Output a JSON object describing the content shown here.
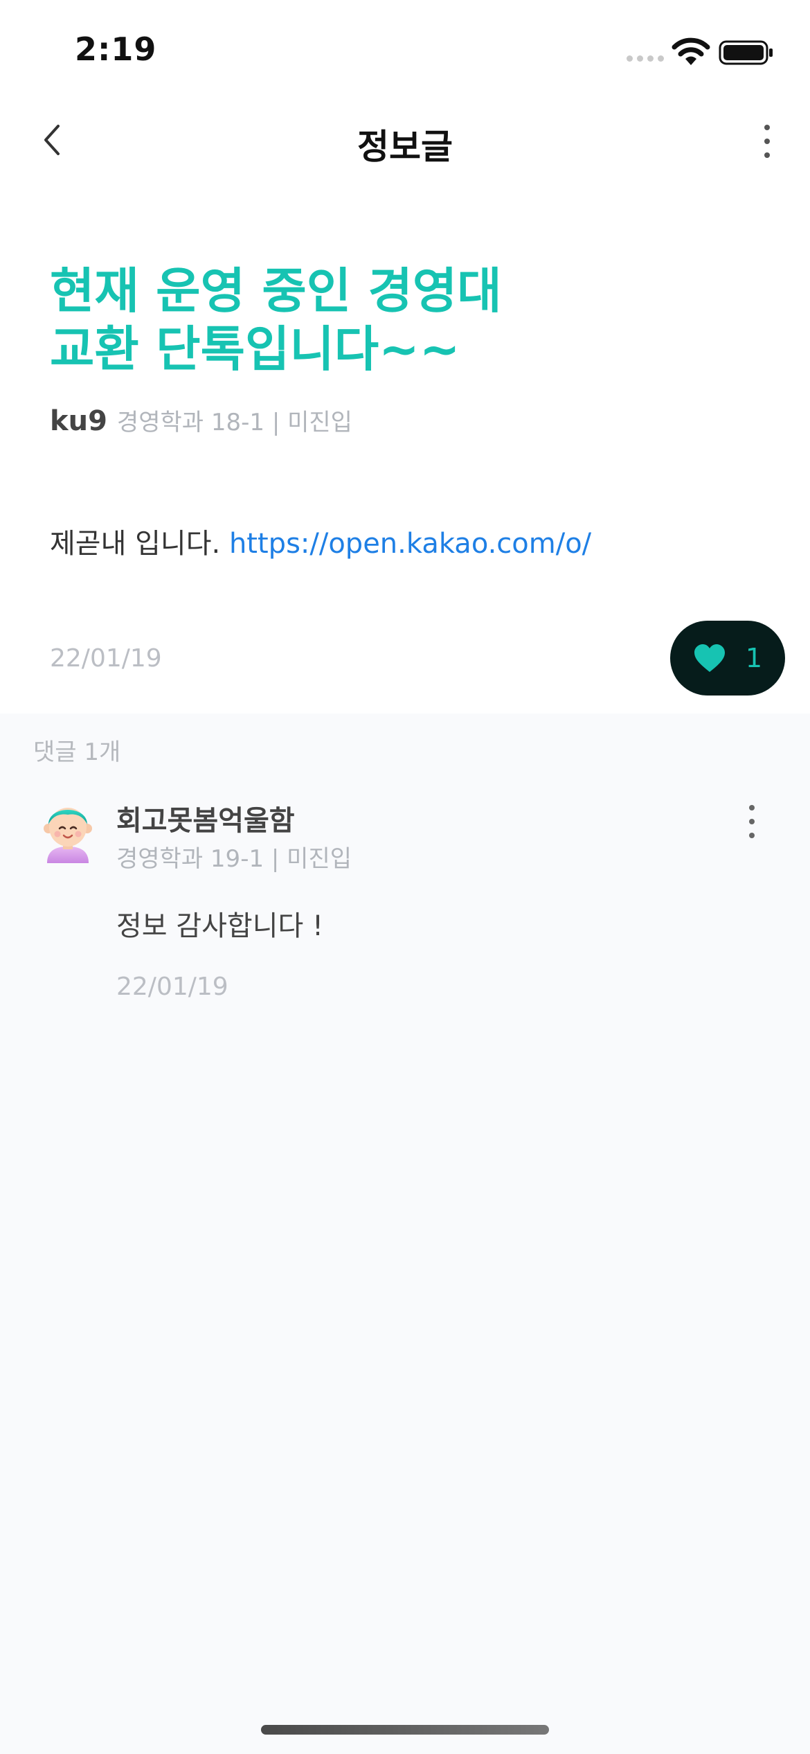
{
  "status_bar": {
    "time": "2:19"
  },
  "nav": {
    "title": "정보글"
  },
  "post": {
    "title_line1": "현재 운영 중인 경영대",
    "title_line2": "교환 단톡입니다~~",
    "author": "ku9",
    "author_info": "경영학과 18-1 | 미진입",
    "body_text": "제곧내 입니다. ",
    "body_link": "https://open.kakao.com/o/",
    "date": "22/01/19",
    "like_count": "1"
  },
  "comments": {
    "count_label": "댓글 1개",
    "items": [
      {
        "name": "회고못봄억울함",
        "info": "경영학과 19-1 | 미진입",
        "body": "정보 감사합니다 !",
        "date": "22/01/19"
      }
    ]
  },
  "colors": {
    "accent": "#17c3b2",
    "link": "#1e7fe5",
    "like_bg": "#061c1b"
  }
}
